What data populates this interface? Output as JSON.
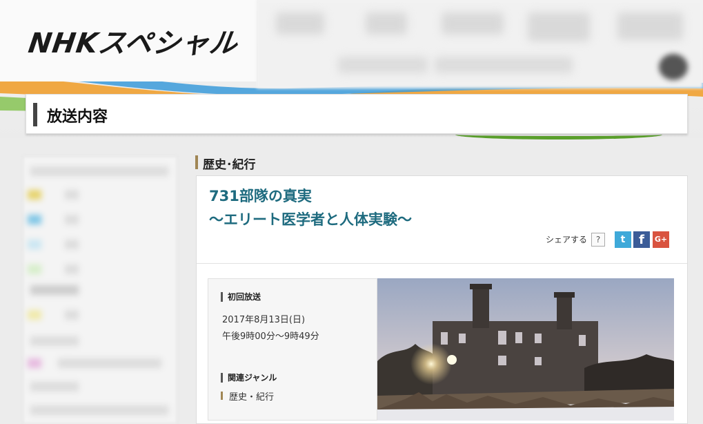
{
  "header": {
    "logo_text": "NHKスペシャル",
    "swoosh_colors": [
      "#f0a030",
      "#3a9ad9",
      "#6cbf3a"
    ]
  },
  "page_title": "放送内容",
  "category": "歴史･紀行",
  "program": {
    "title_line1": "731部隊の真実",
    "title_line2": "〜エリート医学者と人体実験〜"
  },
  "share": {
    "label": "シェアする",
    "help": "?",
    "twitter_glyph": "t",
    "facebook_glyph": "f",
    "googleplus_glyph": "G+"
  },
  "broadcast": {
    "label": "初回放送",
    "date": "2017年8月13日(日)",
    "time": "午後9時00分〜9時49分"
  },
  "genre": {
    "label": "関連ジャンル",
    "item": "歴史・紀行"
  },
  "icons": {
    "twitter": "twitter-icon",
    "facebook": "facebook-icon",
    "googleplus": "google-plus-icon"
  }
}
